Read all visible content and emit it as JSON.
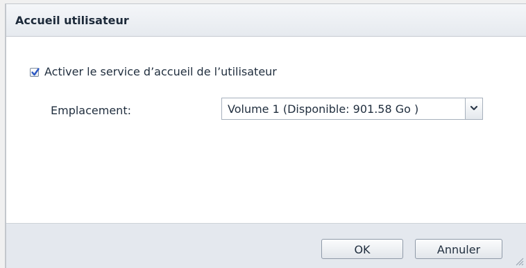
{
  "dialog": {
    "title": "Accueil utilisateur",
    "enable_checkbox": {
      "label": "Activer le service d’accueil de l’utilisateur",
      "checked": true
    },
    "location": {
      "label": "Emplacement:",
      "selected_value": "Volume 1 (Disponible: 901.58 Go )"
    },
    "buttons": {
      "ok_label": "OK",
      "cancel_label": "Annuler"
    }
  },
  "icons": {
    "checkmark": "checkmark-icon",
    "dropdown": "chevron-down-icon",
    "resize": "resize-grip-icon"
  },
  "colors": {
    "accent": "#2b57c2",
    "text": "#1f2d3d",
    "footer_bg": "#e4e8ee"
  }
}
